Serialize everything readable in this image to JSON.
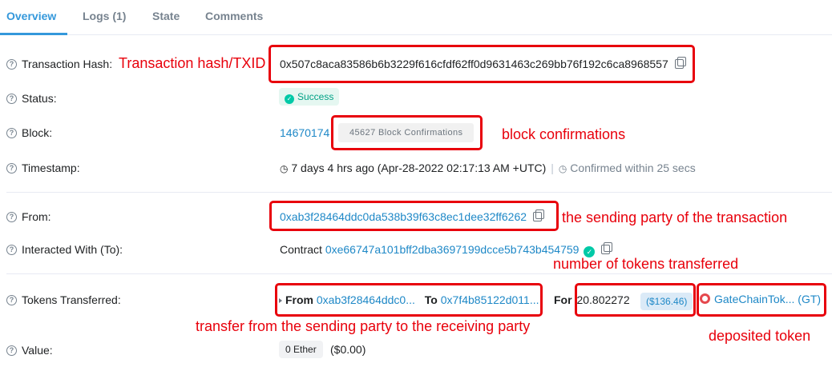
{
  "tabs": [
    {
      "label": "Overview",
      "active": true
    },
    {
      "label": "Logs (1)",
      "active": false
    },
    {
      "label": "State",
      "active": false
    },
    {
      "label": "Comments",
      "active": false
    }
  ],
  "rows": {
    "tx_hash": {
      "label": "Transaction Hash:",
      "value": "0x507c8aca83586b6b3229f616cfdf62ff0d9631463c269bb76f192c6ca8968557"
    },
    "status": {
      "label": "Status:",
      "value": "Success"
    },
    "block": {
      "label": "Block:",
      "value": "14670174",
      "confirmations": "45627 Block Confirmations"
    },
    "timestamp": {
      "label": "Timestamp:",
      "value": "7 days 4 hrs ago (Apr-28-2022 02:17:13 AM +UTC)",
      "confirmed": "Confirmed within 25 secs"
    },
    "from": {
      "label": "From:",
      "value": "0xab3f28464ddc0da538b39f63c8ec1dee32ff6262"
    },
    "interacted": {
      "label": "Interacted With (To):",
      "prefix": "Contract",
      "value": "0xe66747a101bff2dba3697199dcce5b743b454759"
    },
    "tokens": {
      "label": "Tokens Transferred:",
      "from_label": "From",
      "from_value": "0xab3f28464ddc0...",
      "to_label": "To",
      "to_value": "0x7f4b85122d011...",
      "for_label": "For",
      "amount": "20.802272",
      "usd": "($136.46)",
      "token": "GateChainTok... (GT)"
    },
    "value": {
      "label": "Value:",
      "ether": "0 Ether",
      "usd": "($0.00)"
    }
  },
  "annotations": {
    "tx_hash": "Transaction hash/TXID",
    "block_confirmations": "block confirmations",
    "sending_party": "the sending party of the transaction",
    "tokens_number": "number of tokens transferred",
    "transfer": "transfer from the sending party to the receiving party",
    "deposited_token": "deposited token"
  },
  "colors": {
    "accent": "#3498db",
    "link": "#1e88c7",
    "success": "#00a186",
    "annotation": "#e8000b"
  }
}
